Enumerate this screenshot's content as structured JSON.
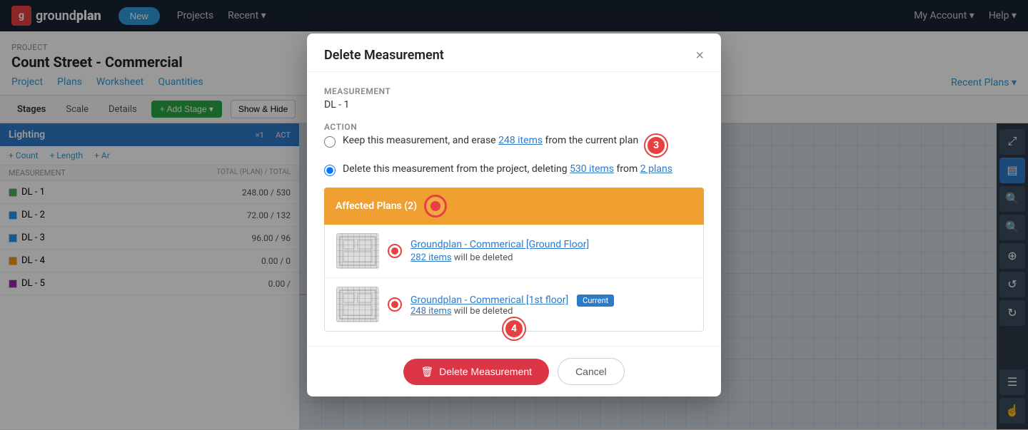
{
  "app": {
    "logo_text_1": "ground",
    "logo_text_2": "plan",
    "new_btn": "New",
    "nav_projects": "Projects",
    "nav_recent": "Recent ▾",
    "nav_my_account": "My Account ▾",
    "nav_help": "Help ▾"
  },
  "subnav": {
    "project_label": "PROJECT",
    "project_title": "Count Street - Commercial",
    "tab_project": "Project",
    "tab_plans": "Plans",
    "tab_worksheet": "Worksheet",
    "tab_quantities": "Quantities",
    "recent_plans": "Recent Plans ▾"
  },
  "toolbar": {
    "tab_stages": "Stages",
    "tab_scale": "Scale",
    "tab_details": "Details",
    "add_stage_btn": "+ Add Stage ▾",
    "show_hide_btn": "Show & Hide"
  },
  "left_panel": {
    "section_title": "Lighting",
    "count_x1": "×1",
    "count_act": "ACT",
    "btn_count": "+ Count",
    "btn_length": "+ Length",
    "btn_area": "+ Ar",
    "col_measurement": "MEASUREMENT",
    "col_total": "TOTAL (PLAN) / TOTAL",
    "rows": [
      {
        "color": "#4CAF50",
        "name": "DL - 1",
        "total": "248.00 / 530"
      },
      {
        "color": "#2196F3",
        "name": "DL - 2",
        "total": "72.00 / 132"
      },
      {
        "color": "#2196F3",
        "name": "DL - 3",
        "total": "96.00 / 96"
      },
      {
        "color": "#FF9800",
        "name": "DL - 4",
        "total": "0.00 / 0"
      },
      {
        "color": "#9C27B0",
        "name": "DL - 5",
        "total": "0.00 /"
      }
    ]
  },
  "modal": {
    "title": "Delete Measurement",
    "close_label": "×",
    "measurement_label": "Measurement",
    "measurement_value": "DL - 1",
    "action_label": "Action",
    "option1_text": "Keep this measurement, and erase ",
    "option1_link": "248 items",
    "option1_text2": " from the current plan",
    "option2_text": "Delete this measurement from the project, deleting ",
    "option2_link1": "530 items",
    "option2_text2": " from ",
    "option2_link2": "2 plans",
    "affected_plans_header": "Affected Plans (2)",
    "annotation3": "3",
    "annotation_circle_header": "●",
    "plans": [
      {
        "name": "Groundplan - Commerical [Ground Floor]",
        "delete_text_prefix": "",
        "delete_link": "282 items",
        "delete_text_suffix": " will be deleted",
        "current": false
      },
      {
        "name": "Groundplan - Commerical [1st floor]",
        "delete_text_prefix": "",
        "delete_link": "248 items",
        "delete_text_suffix": " will be deleted",
        "current": true,
        "current_badge": "Current"
      }
    ],
    "annotation4": "4",
    "delete_btn": "Delete Measurement",
    "cancel_btn": "Cancel",
    "trash_icon": "🗑"
  }
}
